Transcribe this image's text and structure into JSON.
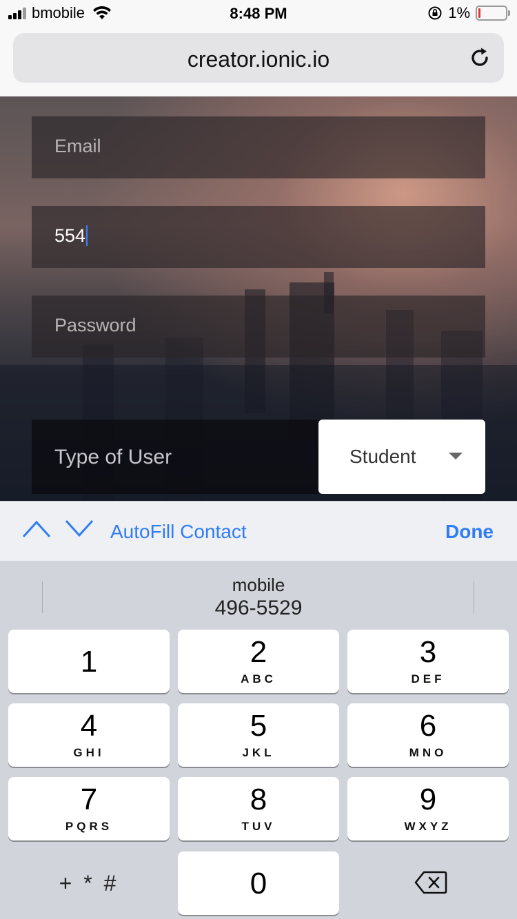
{
  "status_bar": {
    "carrier": "bmobile",
    "time": "8:48 PM",
    "battery_percent": "1%",
    "battery_level": 0.01
  },
  "browser": {
    "url": "creator.ionic.io"
  },
  "form": {
    "email_placeholder": "Email",
    "phone_value": "554",
    "password_placeholder": "Password",
    "type_label": "Type of User",
    "type_selected": "Student"
  },
  "accessory": {
    "autofill_label": "AutoFill Contact",
    "done_label": "Done"
  },
  "keyboard": {
    "suggestion_label": "mobile",
    "suggestion_value": "496-5529",
    "keys": [
      {
        "digit": "1",
        "letters": ""
      },
      {
        "digit": "2",
        "letters": "ABC"
      },
      {
        "digit": "3",
        "letters": "DEF"
      },
      {
        "digit": "4",
        "letters": "GHI"
      },
      {
        "digit": "5",
        "letters": "JKL"
      },
      {
        "digit": "6",
        "letters": "MNO"
      },
      {
        "digit": "7",
        "letters": "PQRS"
      },
      {
        "digit": "8",
        "letters": "TUV"
      },
      {
        "digit": "9",
        "letters": "WXYZ"
      }
    ],
    "symbols_key": "+ * #",
    "zero_key": "0"
  }
}
